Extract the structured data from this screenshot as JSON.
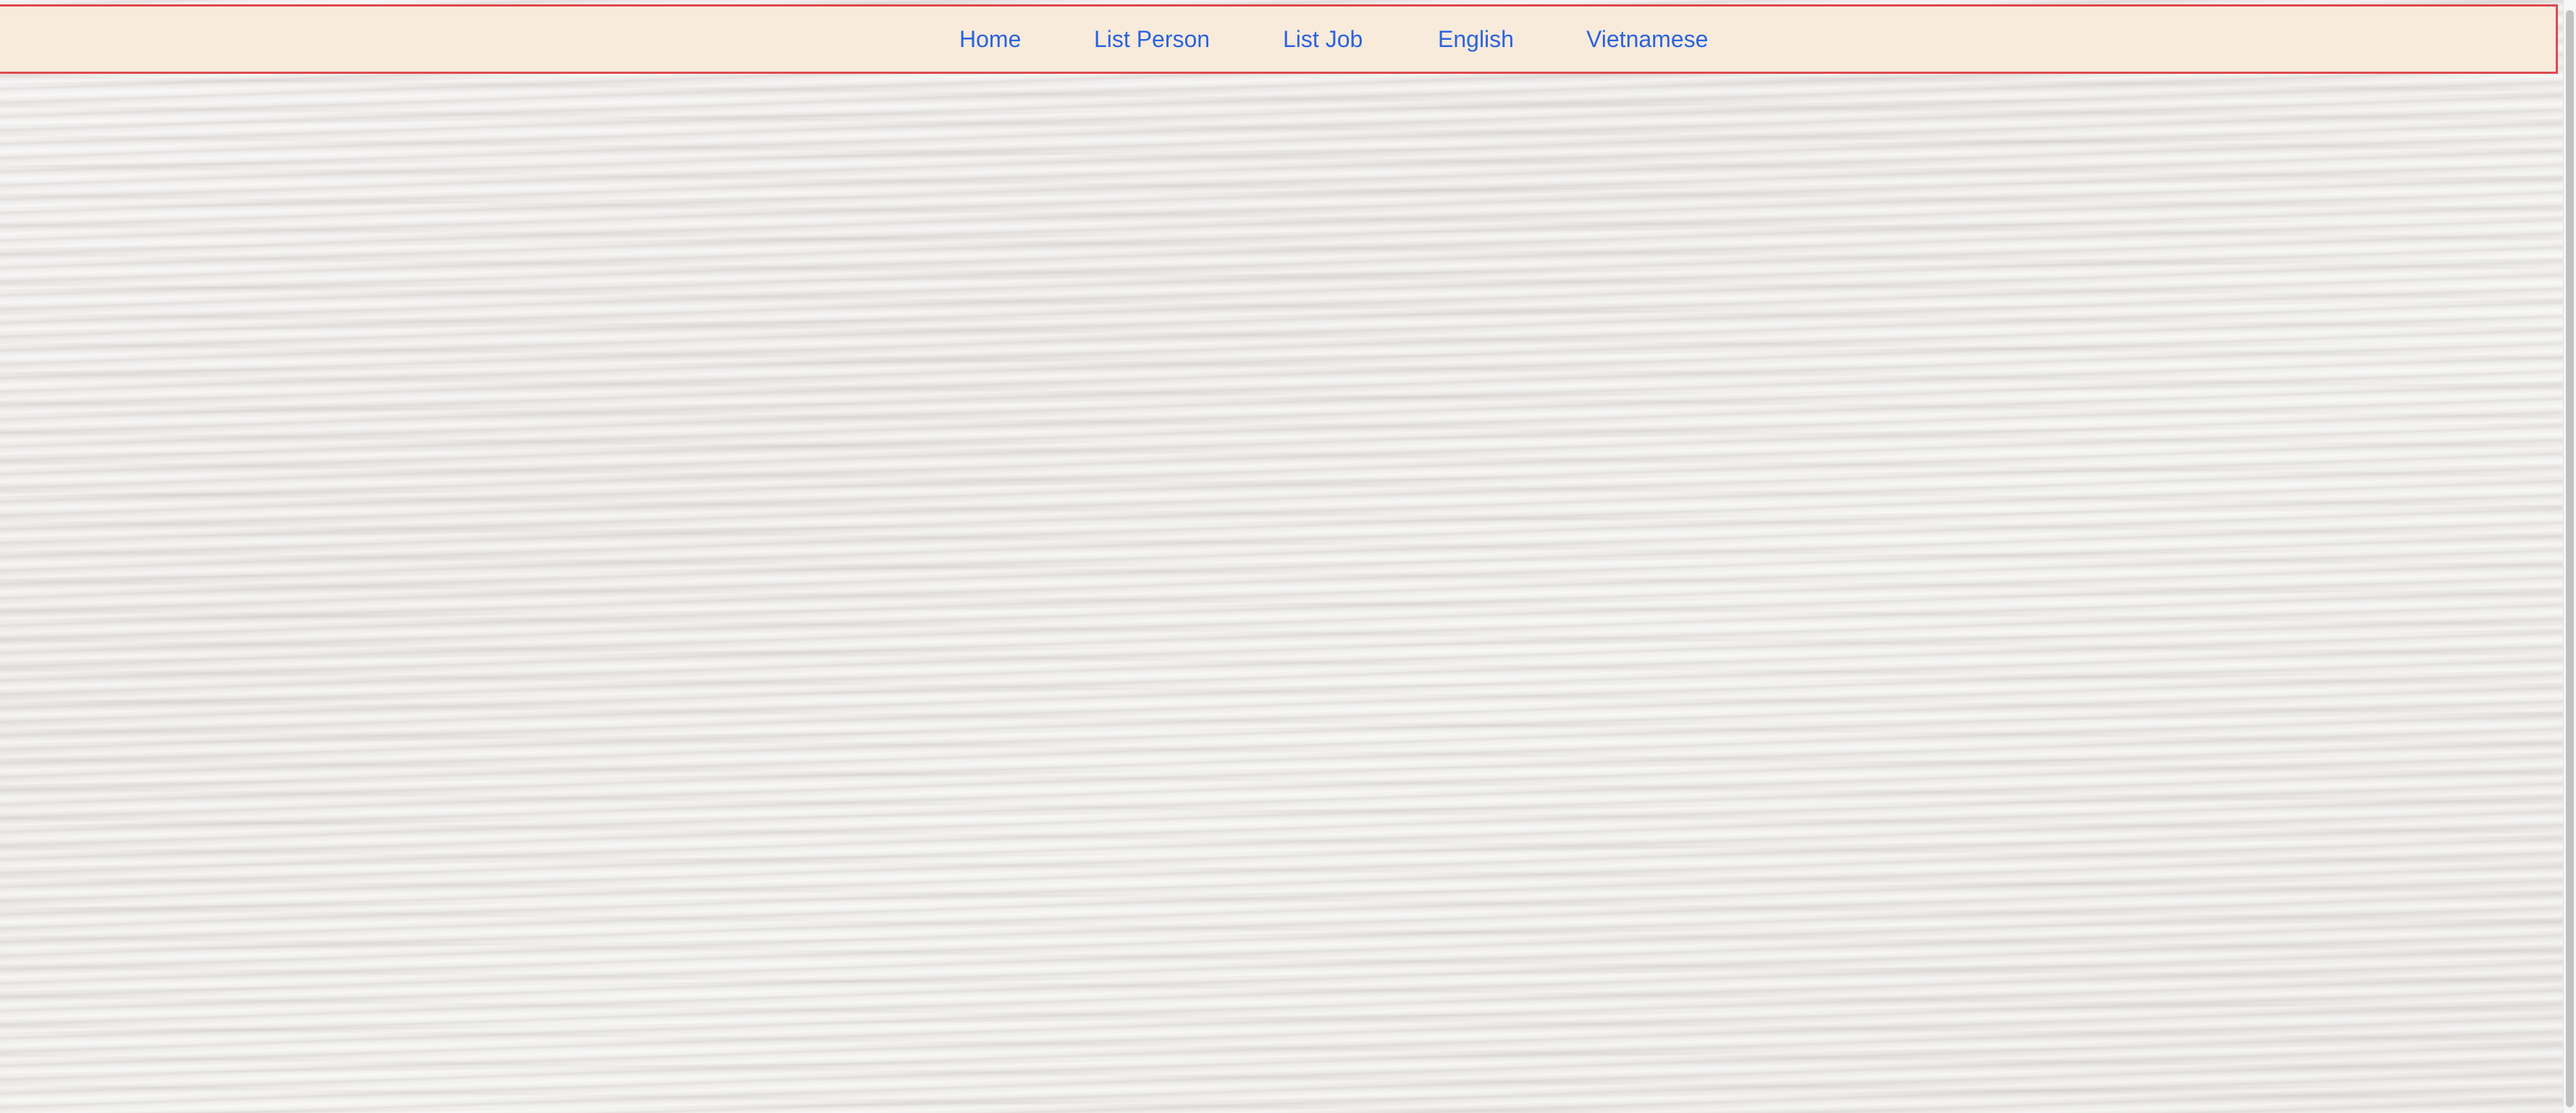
{
  "navbar": {
    "items": [
      {
        "label": "Home"
      },
      {
        "label": "List Person"
      },
      {
        "label": "List Job"
      },
      {
        "label": "English"
      },
      {
        "label": "Vietnamese"
      }
    ]
  },
  "colors": {
    "navbar_background": "#f8ebdc",
    "navbar_border": "#e0484b",
    "link": "#2a63de",
    "page_background": "#e9e7e5"
  }
}
